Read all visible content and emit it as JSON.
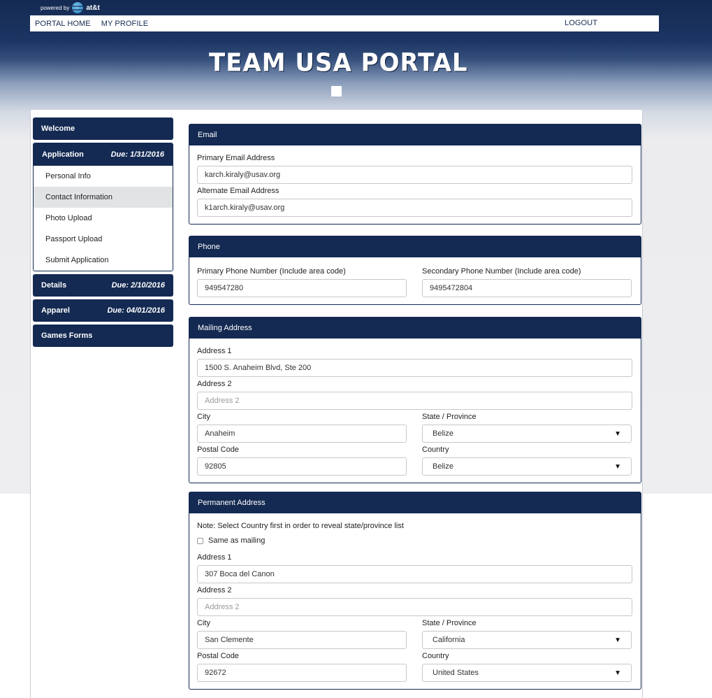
{
  "header": {
    "powered_by": "powered by",
    "att_brand": "at&t",
    "nav": {
      "home": "PORTAL HOME",
      "profile": "MY PROFILE",
      "logout": "LOGOUT"
    },
    "title": "TEAM USA PORTAL"
  },
  "sidebar": {
    "welcome": "Welcome",
    "application": {
      "label": "Application",
      "due": "Due: 1/31/2016"
    },
    "items": [
      "Personal Info",
      "Contact Information",
      "Photo Upload",
      "Passport Upload",
      "Submit Application"
    ],
    "details": {
      "label": "Details",
      "due": "Due: 2/10/2016"
    },
    "apparel": {
      "label": "Apparel",
      "due": "Due: 04/01/2016"
    },
    "games": "Games Forms"
  },
  "email": {
    "title": "Email",
    "primary_label": "Primary Email Address",
    "primary_value": "karch.kiraly@usav.org",
    "alternate_label": "Alternate Email Address",
    "alternate_value": "k1arch.kiraly@usav.org"
  },
  "phone": {
    "title": "Phone",
    "primary_label": "Primary Phone Number (Include area code)",
    "primary_value": "949547280",
    "secondary_label": "Secondary Phone Number (Include area code)",
    "secondary_value": "9495472804"
  },
  "mailing": {
    "title": "Mailing Address",
    "address1_label": "Address 1",
    "address1_value": "1500 S. Anaheim Blvd, Ste 200",
    "address2_label": "Address 2",
    "address2_placeholder": "Address 2",
    "city_label": "City",
    "city_value": "Anaheim",
    "state_label": "State / Province",
    "state_value": "Belize",
    "postal_label": "Postal Code",
    "postal_value": "92805",
    "country_label": "Country",
    "country_value": "Belize"
  },
  "permanent": {
    "title": "Permanent Address",
    "note": "Note: Select Country first in order to reveal state/province list",
    "same_label": "Same as mailing",
    "address1_label": "Address 1",
    "address1_value": "307 Boca del Canon",
    "address2_label": "Address 2",
    "address2_placeholder": "Address 2",
    "city_label": "City",
    "city_value": "San Clemente",
    "state_label": "State / Province",
    "state_value": "California",
    "postal_label": "Postal Code",
    "postal_value": "92672",
    "country_label": "Country",
    "country_value": "United States"
  },
  "colors": {
    "navy": "#142a52",
    "active_row": "#e2e3e5"
  }
}
